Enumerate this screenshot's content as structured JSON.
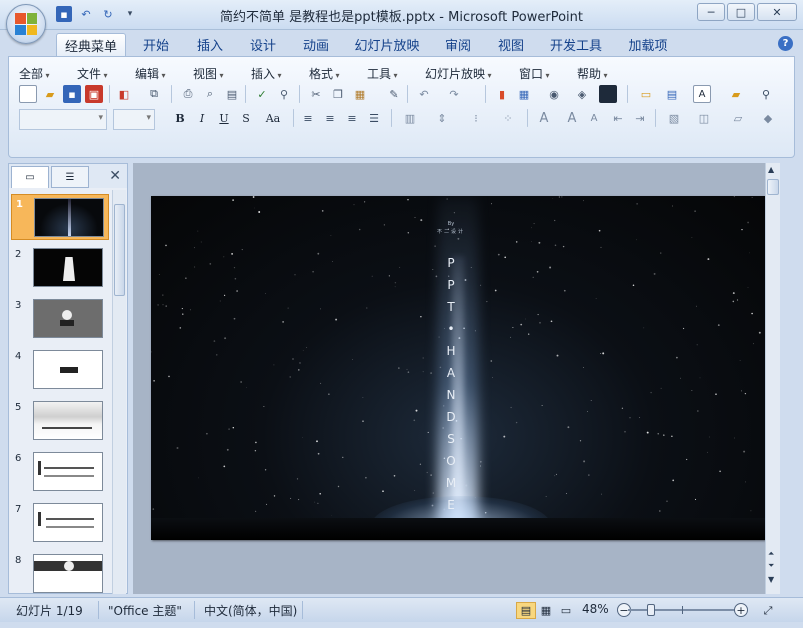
{
  "window": {
    "title": "简约不简单 是教程也是ppt模板.pptx - Microsoft PowerPoint",
    "minimize": "─",
    "maximize": "□",
    "close": "✕"
  },
  "ribbon_tabs": [
    {
      "label": "经典菜单",
      "active": true
    },
    {
      "label": "开始"
    },
    {
      "label": "插入"
    },
    {
      "label": "设计"
    },
    {
      "label": "动画"
    },
    {
      "label": "幻灯片放映"
    },
    {
      "label": "审阅"
    },
    {
      "label": "视图"
    },
    {
      "label": "开发工具"
    },
    {
      "label": "加载项"
    }
  ],
  "classic_menu": [
    {
      "label": "全部"
    },
    {
      "label": "文件"
    },
    {
      "label": "编辑"
    },
    {
      "label": "视图"
    },
    {
      "label": "插入"
    },
    {
      "label": "格式"
    },
    {
      "label": "工具"
    },
    {
      "label": "幻灯片放映"
    },
    {
      "label": "窗口"
    },
    {
      "label": "帮助"
    }
  ],
  "format_buttons": {
    "bold": "B",
    "italic": "I",
    "underline": "U",
    "shadow": "S",
    "case": "Aa"
  },
  "slides_panel": {
    "thumbnails": [
      {
        "num": "1",
        "selected": true
      },
      {
        "num": "2"
      },
      {
        "num": "3"
      },
      {
        "num": "4"
      },
      {
        "num": "5"
      },
      {
        "num": "6"
      },
      {
        "num": "7"
      },
      {
        "num": "8"
      }
    ],
    "close_label": "✕"
  },
  "slide": {
    "by": "By",
    "author": "不二设计",
    "vertical_letters": [
      "P",
      "P",
      "T",
      "•",
      "H",
      "A",
      "N",
      "D",
      "S",
      "O",
      "M",
      "E"
    ]
  },
  "status_bar": {
    "slide_counter": "幻灯片 1/19",
    "theme": "\"Office 主题\"",
    "language": "中文(简体，中国)",
    "zoom": "48%",
    "zoom_fraction": 0.48
  },
  "colors": {
    "accent": "#15428b",
    "selection": "#f7b75a",
    "ribbon_bg": "#cfdcee"
  }
}
